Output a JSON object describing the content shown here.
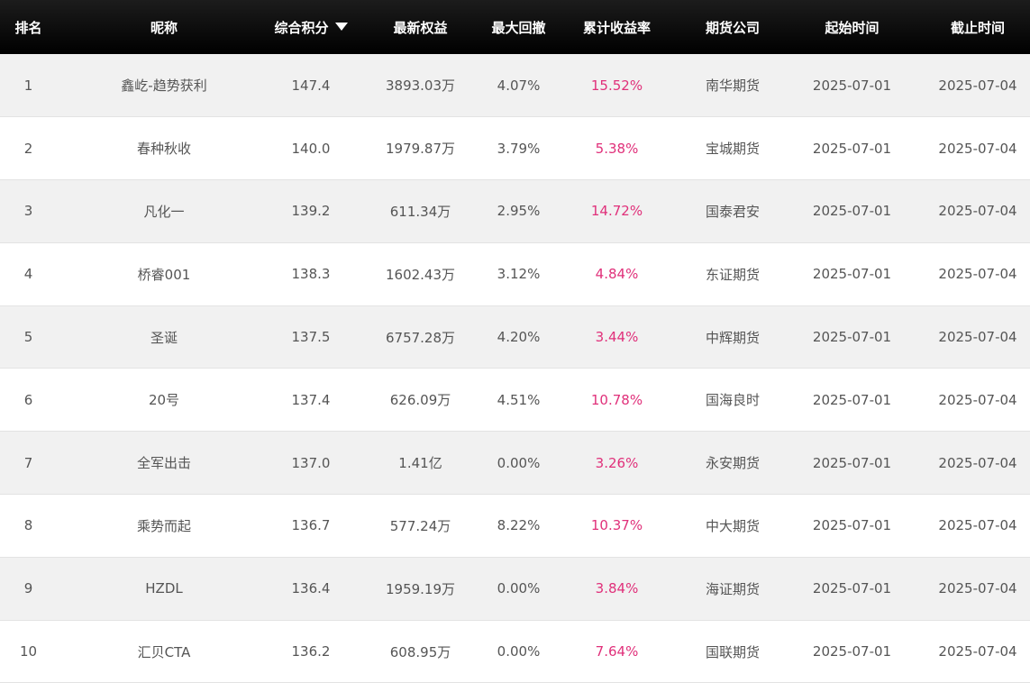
{
  "table": {
    "headers": [
      "排名",
      "昵称",
      "综合积分",
      "最新权益",
      "最大回撤",
      "累计收益率",
      "期货公司",
      "起始时间",
      "截止时间"
    ],
    "sort_icon": "caret-down-icon",
    "colors": {
      "header_bg": "#000000",
      "return_text": "#e0307a",
      "stripe": "#f1f1f1"
    },
    "rows": [
      [
        "1",
        "鑫屹-趋势获利",
        "147.4",
        "3893.03万",
        "4.07%",
        "15.52%",
        "南华期货",
        "2025-07-01",
        "2025-07-04"
      ],
      [
        "2",
        "春种秋收",
        "140.0",
        "1979.87万",
        "3.79%",
        "5.38%",
        "宝城期货",
        "2025-07-01",
        "2025-07-04"
      ],
      [
        "3",
        "凡化一",
        "139.2",
        "611.34万",
        "2.95%",
        "14.72%",
        "国泰君安",
        "2025-07-01",
        "2025-07-04"
      ],
      [
        "4",
        "桥睿001",
        "138.3",
        "1602.43万",
        "3.12%",
        "4.84%",
        "东证期货",
        "2025-07-01",
        "2025-07-04"
      ],
      [
        "5",
        "圣诞",
        "137.5",
        "6757.28万",
        "4.20%",
        "3.44%",
        "中辉期货",
        "2025-07-01",
        "2025-07-04"
      ],
      [
        "6",
        "20号",
        "137.4",
        "626.09万",
        "4.51%",
        "10.78%",
        "国海良时",
        "2025-07-01",
        "2025-07-04"
      ],
      [
        "7",
        "全军出击",
        "137.0",
        "1.41亿",
        "0.00%",
        "3.26%",
        "永安期货",
        "2025-07-01",
        "2025-07-04"
      ],
      [
        "8",
        "乘势而起",
        "136.7",
        "577.24万",
        "8.22%",
        "10.37%",
        "中大期货",
        "2025-07-01",
        "2025-07-04"
      ],
      [
        "9",
        "HZDL",
        "136.4",
        "1959.19万",
        "0.00%",
        "3.84%",
        "海证期货",
        "2025-07-01",
        "2025-07-04"
      ],
      [
        "10",
        "汇贝CTA",
        "136.2",
        "608.95万",
        "0.00%",
        "7.64%",
        "国联期货",
        "2025-07-01",
        "2025-07-04"
      ]
    ]
  }
}
